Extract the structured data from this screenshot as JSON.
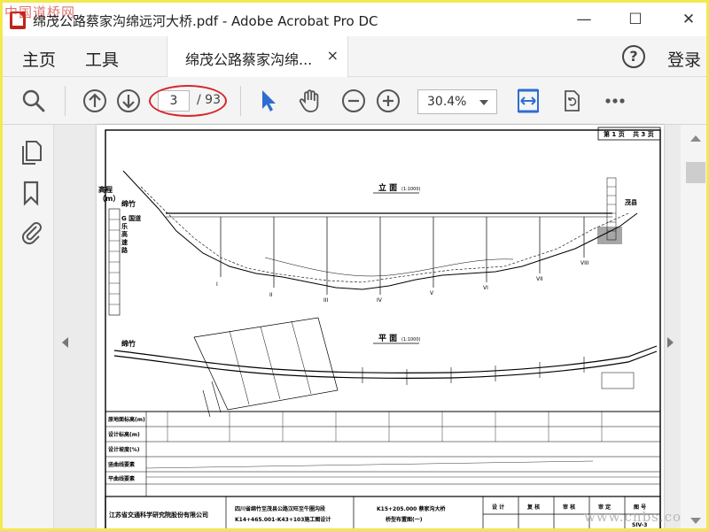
{
  "window": {
    "title": "绵茂公路蔡家沟绵远河大桥.pdf - Adobe Acrobat Pro DC",
    "minimize": "—",
    "maximize": "☐",
    "close": "✕",
    "watermark": "中国道桥网"
  },
  "tabs": {
    "home": "主页",
    "tools": "工具",
    "document": "绵茂公路蔡家沟绵...",
    "document_close": "×",
    "help": "?",
    "signin": "登录"
  },
  "toolbar": {
    "page_current": "3",
    "page_total": "/ 93",
    "zoom": "30.4%"
  },
  "drawing": {
    "page_header": [
      "第 1 页",
      "共 3 页"
    ],
    "elevation_title": "立 面",
    "elevation_scale": "(1:1000)",
    "plan_title": "平 面",
    "plan_scale": "(1:1000)",
    "left_label": "高程\n（m）",
    "left_road": "绵竹",
    "left_vertical": "G 国道\n乐\n高\n速\n路",
    "right_label": "茂县",
    "plan_start": "绵竹",
    "table_rows": [
      "原地面标高(m)",
      "设计标高(m)",
      "设计坡度(%)",
      "竖曲线要素",
      "平曲线要素"
    ],
    "company": "江苏省交通科学研究院股份有限公司",
    "project_line1": "四川省绵竹至茂县公路汉旺至牛圈沟段",
    "project_line2": "K14+465.001-K43+103施工图设计",
    "bridge_line1": "K15+205.000 蔡家沟大桥",
    "bridge_line2": "桥型布置图(一)",
    "sign_labels": [
      "设 计",
      "复 核",
      "审 核",
      "审 定",
      "图 号"
    ],
    "drawing_no": "SIV-3",
    "watermark": "www.cnbs.com"
  }
}
